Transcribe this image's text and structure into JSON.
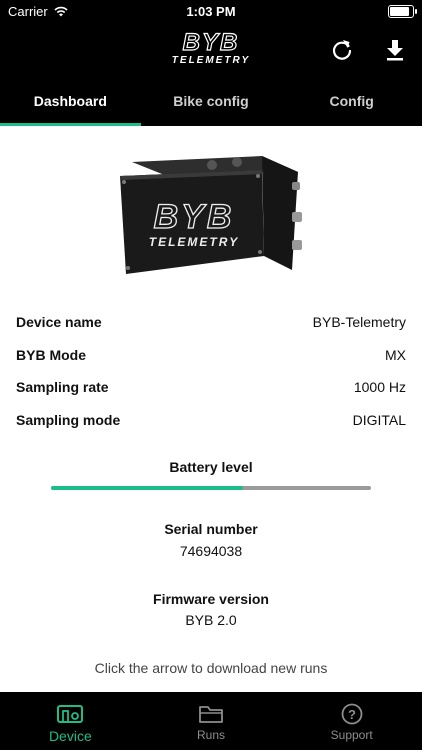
{
  "status_bar": {
    "carrier": "Carrier",
    "time": "1:03 PM"
  },
  "header": {
    "logo_line1": "BYB",
    "logo_line2": "TELEMETRY",
    "actions": [
      "refresh-icon",
      "download-icon"
    ]
  },
  "tabs": [
    {
      "label": "Dashboard",
      "active": true
    },
    {
      "label": "Bike config",
      "active": false
    },
    {
      "label": "Config",
      "active": false
    }
  ],
  "device_image": {
    "brand": "BYB",
    "sub": "TELEMETRY"
  },
  "info": [
    {
      "label": "Device name",
      "value": "BYB-Telemetry"
    },
    {
      "label": "BYB Mode",
      "value": "MX"
    },
    {
      "label": "Sampling rate",
      "value": "1000 Hz"
    },
    {
      "label": "Sampling mode",
      "value": "DIGITAL"
    }
  ],
  "battery": {
    "label": "Battery level",
    "level": 0.6
  },
  "serial": {
    "label": "Serial number",
    "value": "74694038"
  },
  "firmware": {
    "label": "Firmware version",
    "value": "BYB 2.0"
  },
  "hint": "Click the arrow to download new runs",
  "bottom_nav": [
    {
      "label": "Device",
      "icon": "device-icon",
      "active": true
    },
    {
      "label": "Runs",
      "icon": "folder-icon",
      "active": false
    },
    {
      "label": "Support",
      "icon": "help-icon",
      "active": false
    }
  ],
  "colors": {
    "accent": "#1dbd8a",
    "bar_bg": "#9b9b9b",
    "header_bg": "#000000"
  }
}
